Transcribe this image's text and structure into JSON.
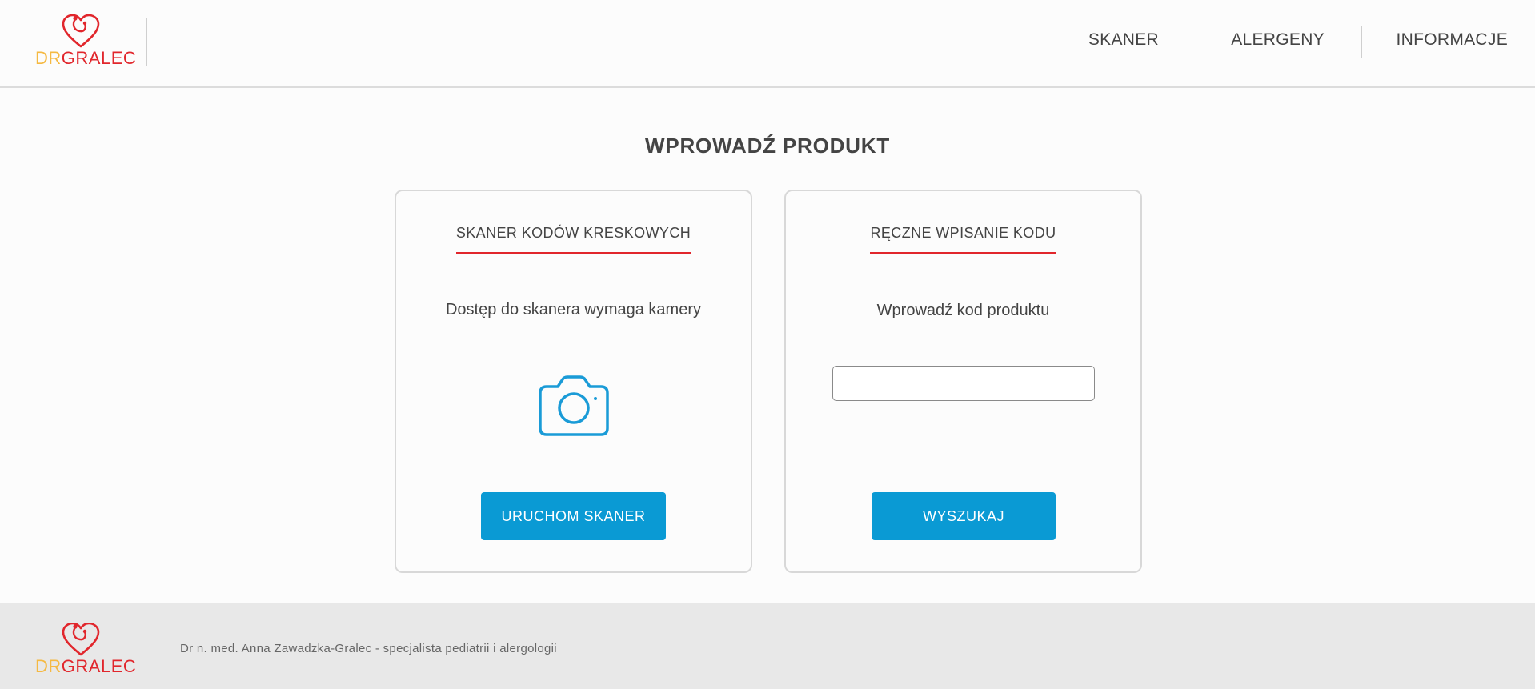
{
  "brand": {
    "logo_prefix": "DR",
    "logo_name": "GRALEC",
    "accent_color": "#e1262c",
    "prefix_color": "#f5b942"
  },
  "nav": {
    "items": [
      {
        "label": "SKANER"
      },
      {
        "label": "ALERGENY"
      },
      {
        "label": "INFORMACJE"
      }
    ]
  },
  "main": {
    "title": "WPROWADŹ PRODUKT",
    "scanner_card": {
      "title": "SKANER KODÓW KRESKOWYCH",
      "description": "Dostęp do skanera wymaga kamery",
      "icon": "camera-icon",
      "button_label": "URUCHOM SKANER"
    },
    "manual_card": {
      "title": "RĘCZNE WPISANIE KODU",
      "description": "Wprowadź kod produktu",
      "input_value": "",
      "button_label": "WYSZUKAJ"
    },
    "button_color": "#0a9ad4"
  },
  "footer": {
    "text": "Dr n. med. Anna Zawadzka-Gralec - specjalista pediatrii i alergologii"
  }
}
